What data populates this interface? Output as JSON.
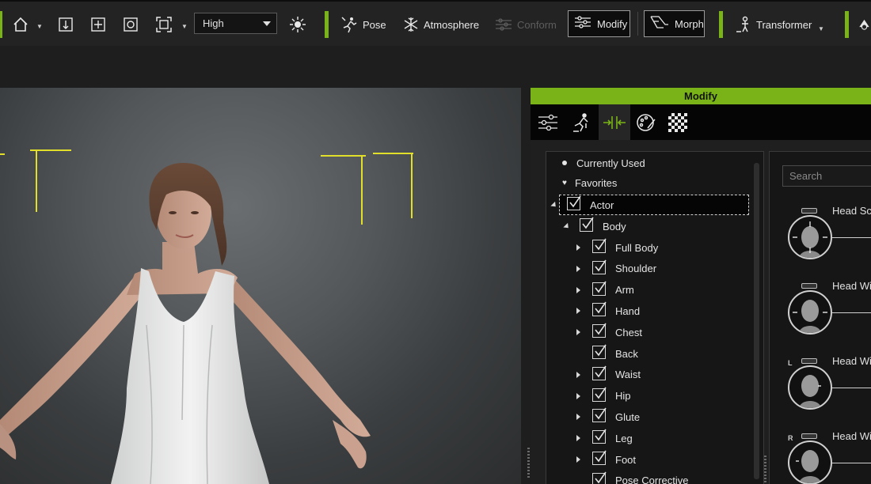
{
  "toolbar": {
    "quality_value": "High",
    "buttons": [
      {
        "label": "Pose",
        "icon": "pose-icon"
      },
      {
        "label": "Atmosphere",
        "icon": "atmosphere-icon"
      },
      {
        "label": "Conform",
        "icon": "conform-icon",
        "disabled": true
      },
      {
        "label": "Modify",
        "icon": "modify-icon"
      },
      {
        "label": "Morph",
        "icon": "morph-icon"
      },
      {
        "label": "Transformer",
        "icon": "transformer-icon"
      }
    ],
    "accent_color": "#7ab317"
  },
  "panel": {
    "title": "Modify",
    "tabs": [
      "sliders-tab-icon",
      "motion-tab-icon",
      "morph-tab-icon",
      "appearance-tab-icon",
      "checker-tab-icon"
    ],
    "tree": {
      "special": [
        {
          "label": "Currently Used",
          "icon": "bullet-icon"
        },
        {
          "label": "Favorites",
          "icon": "heart-icon"
        }
      ],
      "actor_label": "Actor",
      "body_label": "Body",
      "items": [
        {
          "label": "Full Body",
          "expandable": true
        },
        {
          "label": "Shoulder",
          "expandable": true
        },
        {
          "label": "Arm",
          "expandable": true
        },
        {
          "label": "Hand",
          "expandable": true
        },
        {
          "label": "Chest",
          "expandable": true
        },
        {
          "label": "Back",
          "expandable": false
        },
        {
          "label": "Waist",
          "expandable": true
        },
        {
          "label": "Hip",
          "expandable": true
        },
        {
          "label": "Glute",
          "expandable": true
        },
        {
          "label": "Leg",
          "expandable": true
        },
        {
          "label": "Foot",
          "expandable": true
        },
        {
          "label": "Pose Corrective",
          "expandable": false
        }
      ]
    },
    "search_placeholder": "Search",
    "morph_items": [
      {
        "title": "Head Sc",
        "tag": ""
      },
      {
        "title": "Head Wi",
        "tag": ""
      },
      {
        "title": "Head Wi",
        "tag": "L"
      },
      {
        "title": "Head Wi",
        "tag": "R"
      }
    ]
  }
}
